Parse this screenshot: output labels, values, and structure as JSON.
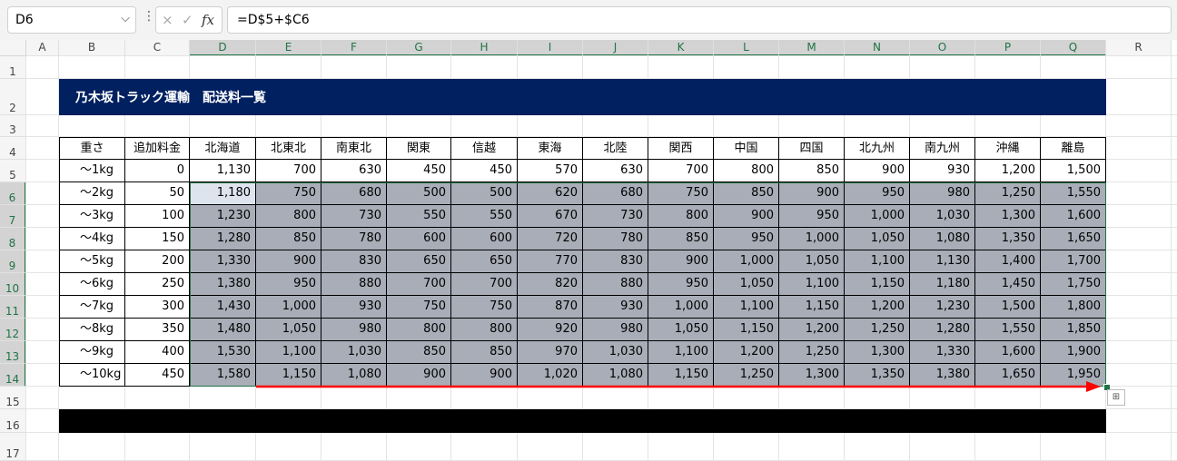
{
  "formula_bar": {
    "name_box": "D6",
    "cancel_icon": "×",
    "enter_icon": "✓",
    "fx_label": "fx",
    "formula": "=D$5+$C6"
  },
  "columns": [
    "A",
    "B",
    "C",
    "D",
    "E",
    "F",
    "G",
    "H",
    "I",
    "J",
    "K",
    "L",
    "M",
    "N",
    "O",
    "P",
    "Q",
    "R"
  ],
  "rows": [
    "1",
    "2",
    "3",
    "4",
    "5",
    "6",
    "7",
    "8",
    "9",
    "10",
    "11",
    "12",
    "13",
    "14",
    "15",
    "16",
    "17"
  ],
  "title": "乃木坂トラック運輸　配送料一覧",
  "table": {
    "headers": [
      "重さ",
      "追加料金",
      "北海道",
      "北東北",
      "南東北",
      "関東",
      "信越",
      "東海",
      "北陸",
      "関西",
      "中国",
      "四国",
      "北九州",
      "南九州",
      "沖縄",
      "離島"
    ],
    "rows": [
      [
        "～1kg",
        "0",
        "1,130",
        "700",
        "630",
        "450",
        "450",
        "570",
        "630",
        "700",
        "800",
        "850",
        "900",
        "930",
        "1,200",
        "1,500"
      ],
      [
        "～2kg",
        "50",
        "1,180",
        "750",
        "680",
        "500",
        "500",
        "620",
        "680",
        "750",
        "850",
        "900",
        "950",
        "980",
        "1,250",
        "1,550"
      ],
      [
        "～3kg",
        "100",
        "1,230",
        "800",
        "730",
        "550",
        "550",
        "670",
        "730",
        "800",
        "900",
        "950",
        "1,000",
        "1,030",
        "1,300",
        "1,600"
      ],
      [
        "～4kg",
        "150",
        "1,280",
        "850",
        "780",
        "600",
        "600",
        "720",
        "780",
        "850",
        "950",
        "1,000",
        "1,050",
        "1,080",
        "1,350",
        "1,650"
      ],
      [
        "～5kg",
        "200",
        "1,330",
        "900",
        "830",
        "650",
        "650",
        "770",
        "830",
        "900",
        "1,000",
        "1,050",
        "1,100",
        "1,130",
        "1,400",
        "1,700"
      ],
      [
        "～6kg",
        "250",
        "1,380",
        "950",
        "880",
        "700",
        "700",
        "820",
        "880",
        "950",
        "1,050",
        "1,100",
        "1,150",
        "1,180",
        "1,450",
        "1,750"
      ],
      [
        "～7kg",
        "300",
        "1,430",
        "1,000",
        "930",
        "750",
        "750",
        "870",
        "930",
        "1,000",
        "1,100",
        "1,150",
        "1,200",
        "1,230",
        "1,500",
        "1,800"
      ],
      [
        "～8kg",
        "350",
        "1,480",
        "1,050",
        "980",
        "800",
        "800",
        "920",
        "980",
        "1,050",
        "1,150",
        "1,200",
        "1,250",
        "1,280",
        "1,550",
        "1,850"
      ],
      [
        "～9kg",
        "400",
        "1,530",
        "1,100",
        "1,030",
        "850",
        "850",
        "970",
        "1,030",
        "1,100",
        "1,200",
        "1,250",
        "1,300",
        "1,330",
        "1,600",
        "1,900"
      ],
      [
        "～10kg",
        "450",
        "1,580",
        "1,150",
        "1,080",
        "900",
        "900",
        "1,020",
        "1,080",
        "1,150",
        "1,250",
        "1,300",
        "1,350",
        "1,380",
        "1,650",
        "1,950"
      ]
    ]
  },
  "colors": {
    "banner": "#002060",
    "selection": "#217346",
    "highlight": "#a9adb8",
    "arrow": "#ff0000"
  }
}
